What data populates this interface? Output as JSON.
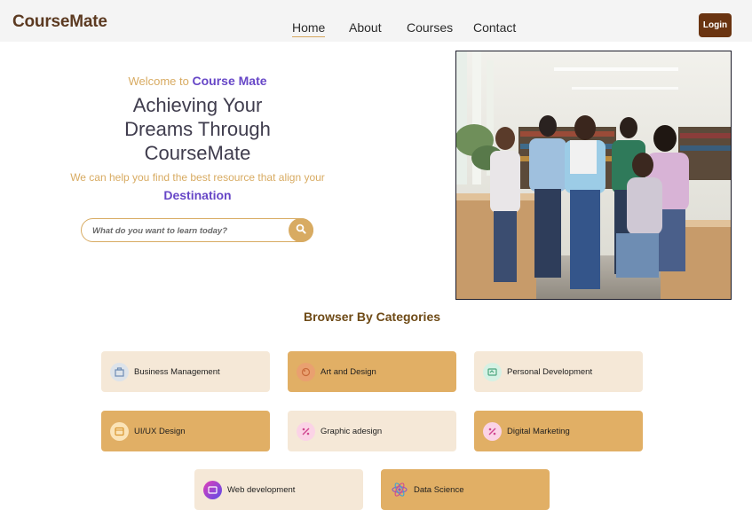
{
  "app": {
    "logo": "CourseMate"
  },
  "nav": {
    "items": [
      {
        "label": "Home",
        "active": true
      },
      {
        "label": "About",
        "active": false
      },
      {
        "label": "Courses",
        "active": false
      },
      {
        "label": "Contact",
        "active": false
      }
    ],
    "login_label": "Login"
  },
  "hero": {
    "welcome_prefix": "Welcome to",
    "welcome_brand": "Course Mate",
    "headline_1": "Achieving Your",
    "headline_2": "Dreams Through",
    "headline_3": "CourseMate",
    "subtitle": "We can help you find the best resource that align your",
    "destination": "Destination",
    "search": {
      "placeholder": "What do you want to learn today?",
      "icon": "search-icon"
    },
    "image_alt": "students-group-photo"
  },
  "categories": {
    "title": "Browser By Categories",
    "items": [
      {
        "label": "Business Management",
        "icon": "business-icon",
        "style": "light"
      },
      {
        "label": "Art and Design",
        "icon": "art-icon",
        "style": "dark"
      },
      {
        "label": "Personal Development",
        "icon": "personal-development-icon",
        "style": "light"
      },
      {
        "label": "UI/UX Design",
        "icon": "uiux-icon",
        "style": "dark"
      },
      {
        "label": "Graphic adesign",
        "icon": "graphic-design-icon",
        "style": "light"
      },
      {
        "label": "Digital Marketing",
        "icon": "digital-marketing-icon",
        "style": "dark"
      },
      {
        "label": "Web development",
        "icon": "web-development-icon",
        "style": "light"
      },
      {
        "label": "Data Science",
        "icon": "data-science-icon",
        "style": "dark"
      }
    ]
  },
  "colors": {
    "brand_purple": "#6747c7",
    "gold": "#d8ab62",
    "brown": "#6a3411",
    "card_light": "#f5e8d7",
    "card_dark": "#e1af65"
  }
}
